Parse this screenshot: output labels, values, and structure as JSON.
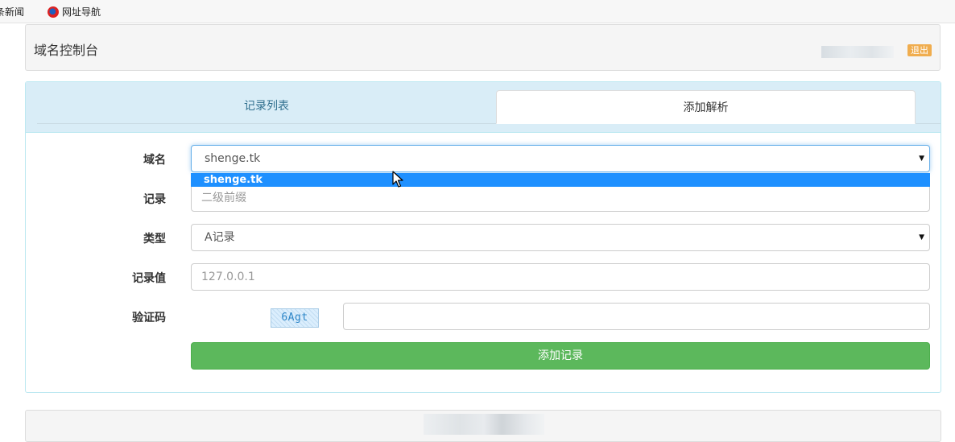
{
  "bookmarks": {
    "news_label": "条新闻",
    "nav_label": "网址导航"
  },
  "header": {
    "title": "域名控制台",
    "logout_label": "退出"
  },
  "tabs": {
    "list_label": "记录列表",
    "add_label": "添加解析"
  },
  "form": {
    "domain_label": "域名",
    "domain_value": "shenge.tk",
    "domain_option": "shenge.tk",
    "record_label": "记录",
    "record_placeholder": "二级前缀",
    "type_label": "类型",
    "type_value": "A记录",
    "value_label": "记录值",
    "value_placeholder": "127.0.0.1",
    "captcha_label": "验证码",
    "captcha_text": "6Agt",
    "submit_label": "添加记录"
  },
  "colors": {
    "panel_info": "#d9edf7",
    "tab_text": "#31708f",
    "success": "#5cb85c",
    "warning": "#f0ad4e",
    "dropdown_highlight": "#1e90ff"
  }
}
